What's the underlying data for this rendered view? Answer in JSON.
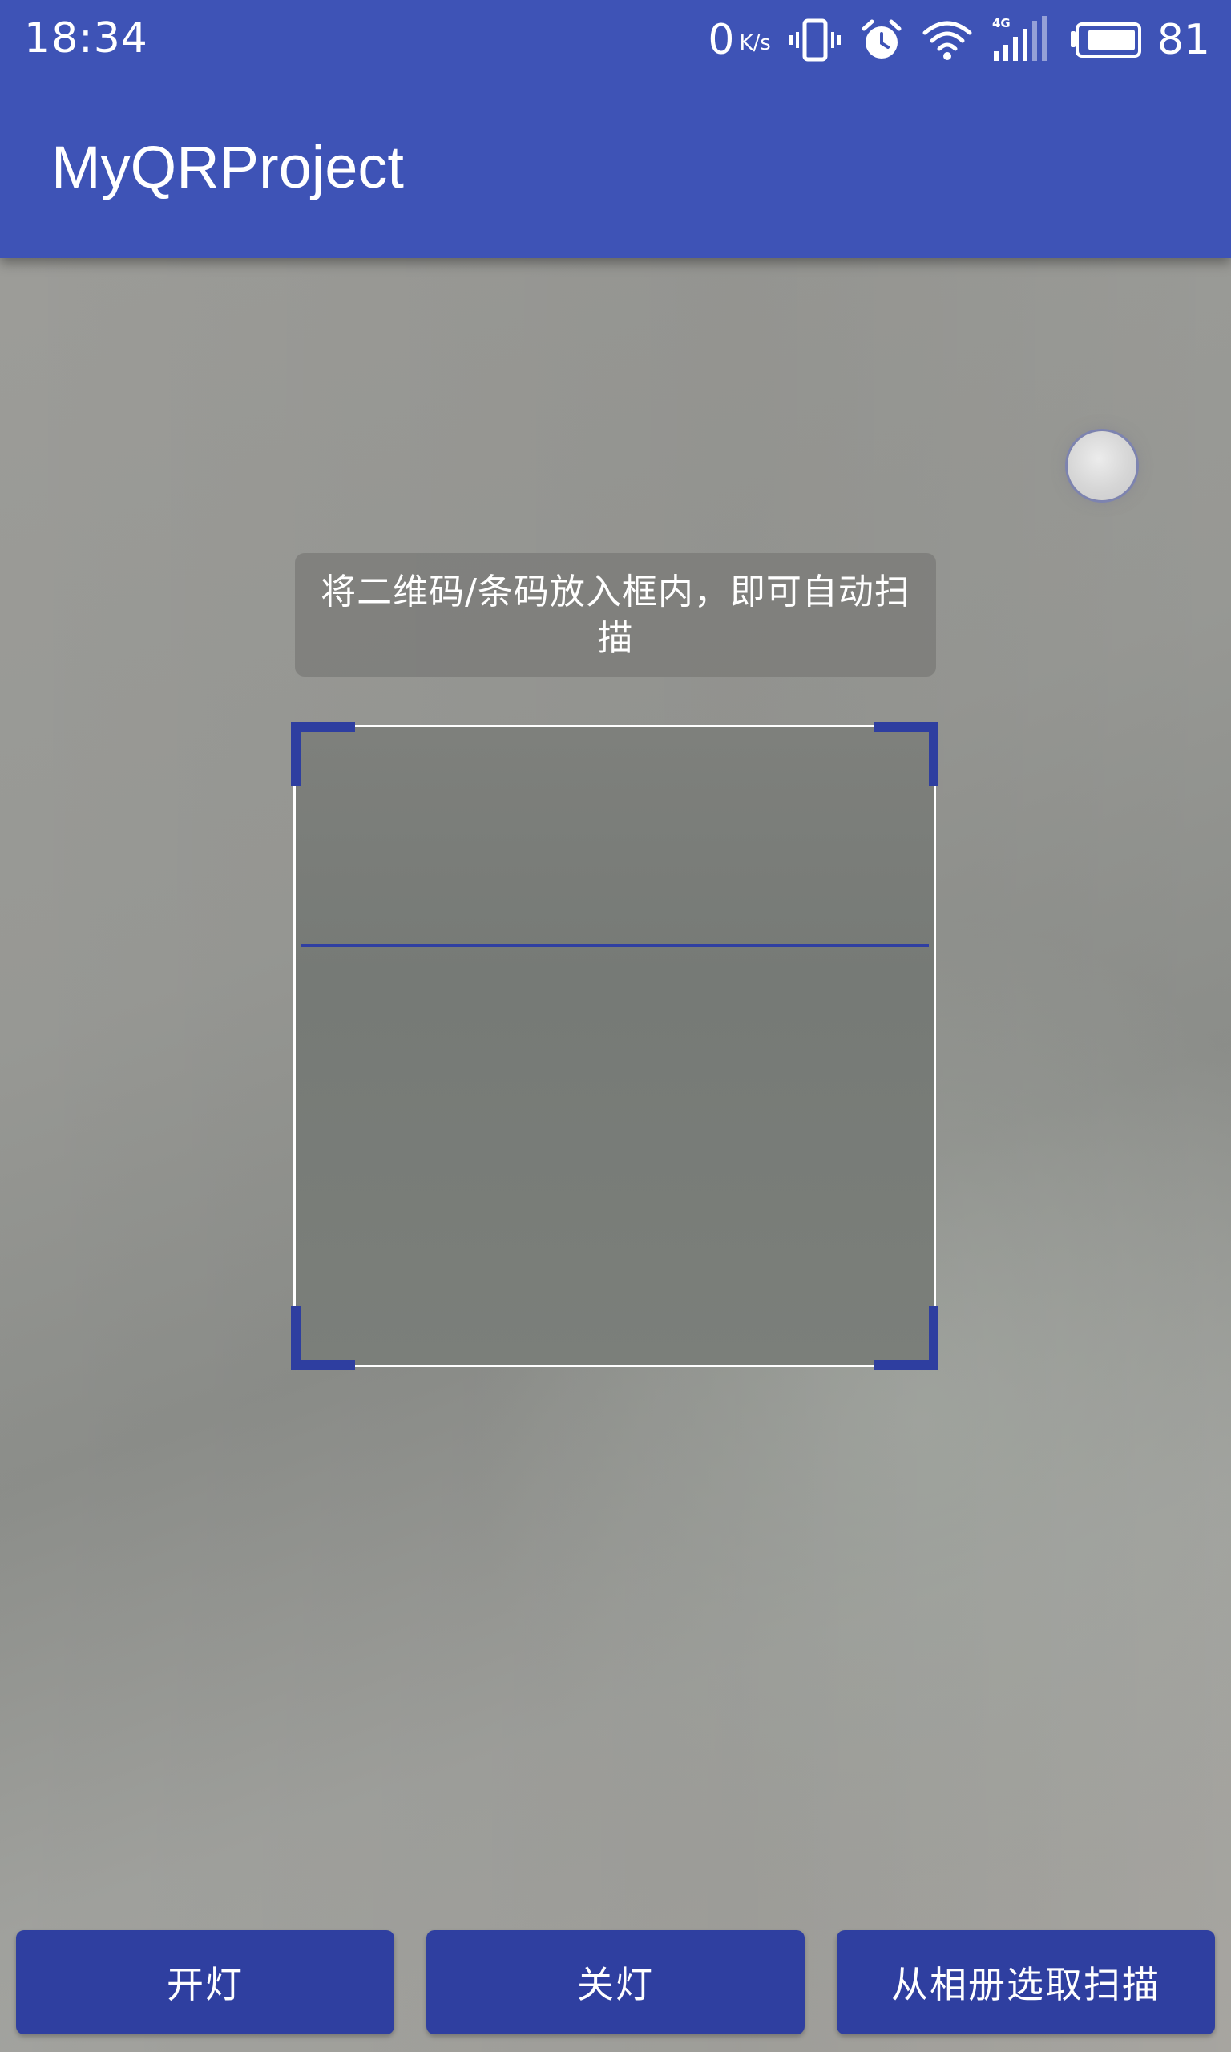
{
  "status_bar": {
    "time": "18:34",
    "net_speed": "0",
    "net_speed_unit": "K/s",
    "battery_percent": "81",
    "icons": [
      "vibrate-icon",
      "alarm-icon",
      "wifi-icon",
      "signal-4g-icon",
      "battery-icon"
    ]
  },
  "app_bar": {
    "title": "MyQRProject",
    "color": "#3e53b6"
  },
  "scanner": {
    "tip": "将二维码/条码放入框内，即可自动扫描",
    "frame_corner_color": "#2e3ea0",
    "laser_color": "#2f3fa2"
  },
  "buttons": {
    "light_on": "开灯",
    "light_off": "关灯",
    "scan_from_album": "从相册选取扫描",
    "color": "#2f3fa0"
  }
}
